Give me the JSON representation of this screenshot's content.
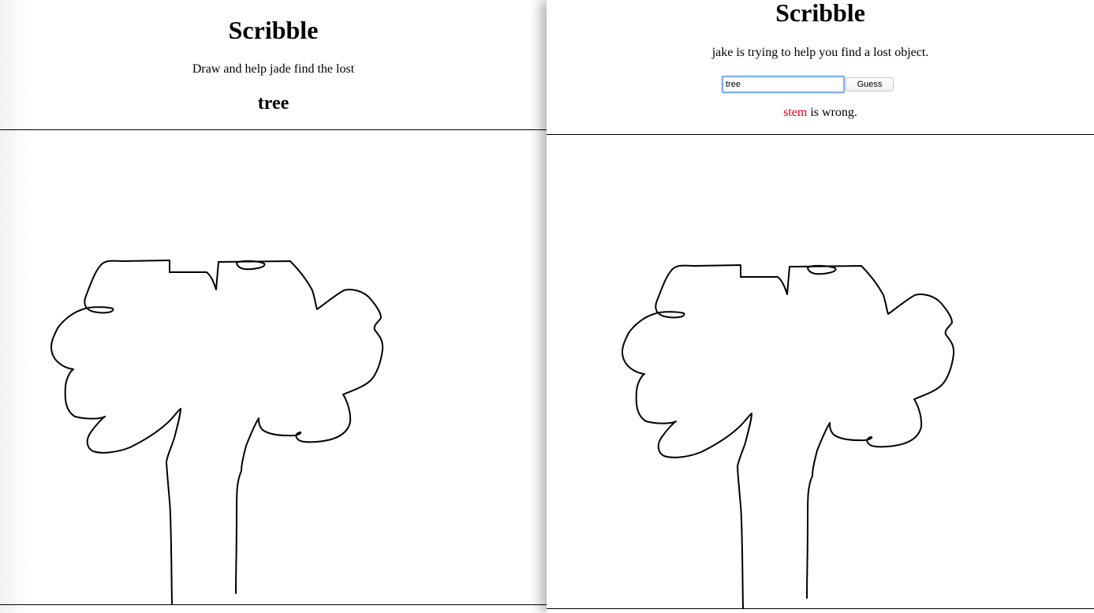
{
  "drawer_view": {
    "title": "Scribble",
    "instruction": "Draw and help jade find the lost",
    "secret_word": "tree"
  },
  "guesser_view": {
    "title": "Scribble",
    "instruction": "jake is trying to help you find a lost object.",
    "guess_input": {
      "value": "tree",
      "placeholder": ""
    },
    "guess_button_label": "Guess",
    "feedback": {
      "wrong_word": "stem",
      "suffix": " is wrong."
    }
  },
  "colors": {
    "wrong_word": "#e0001a",
    "input_focus_border": "#7eaeea",
    "stroke": "#000000"
  },
  "drawing": {
    "stroke_color": "#000000",
    "subject_depicted": "tree-doodle"
  }
}
